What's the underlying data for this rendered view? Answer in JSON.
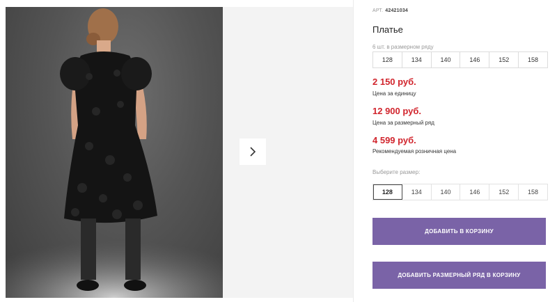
{
  "product": {
    "article_label": "АРТ.",
    "article_number": "42421034",
    "title": "Платье",
    "row_info": "6 шт. в размерном ряду",
    "row_sizes": [
      "128",
      "134",
      "140",
      "146",
      "152",
      "158"
    ]
  },
  "prices": {
    "unit_price": "2 150 руб.",
    "unit_label": "Цена за единицу",
    "row_price": "12 900 руб.",
    "row_label": "Цена за размерный ряд",
    "retail_price": "4 599 руб.",
    "retail_label": "Рекомендуемая розничная цена"
  },
  "size_select": {
    "label": "Выберите размер:",
    "options": [
      "128",
      "134",
      "140",
      "146",
      "152",
      "158"
    ],
    "selected": "128"
  },
  "buttons": {
    "add_to_cart": "ДОБАВИТЬ В КОРЗИНУ",
    "add_row_to_cart": "ДОБАВИТЬ РАЗМЕРНЫЙ РЯД В КОРЗИНУ"
  },
  "colors": {
    "price": "#d1252d",
    "button": "#7a63a7"
  }
}
